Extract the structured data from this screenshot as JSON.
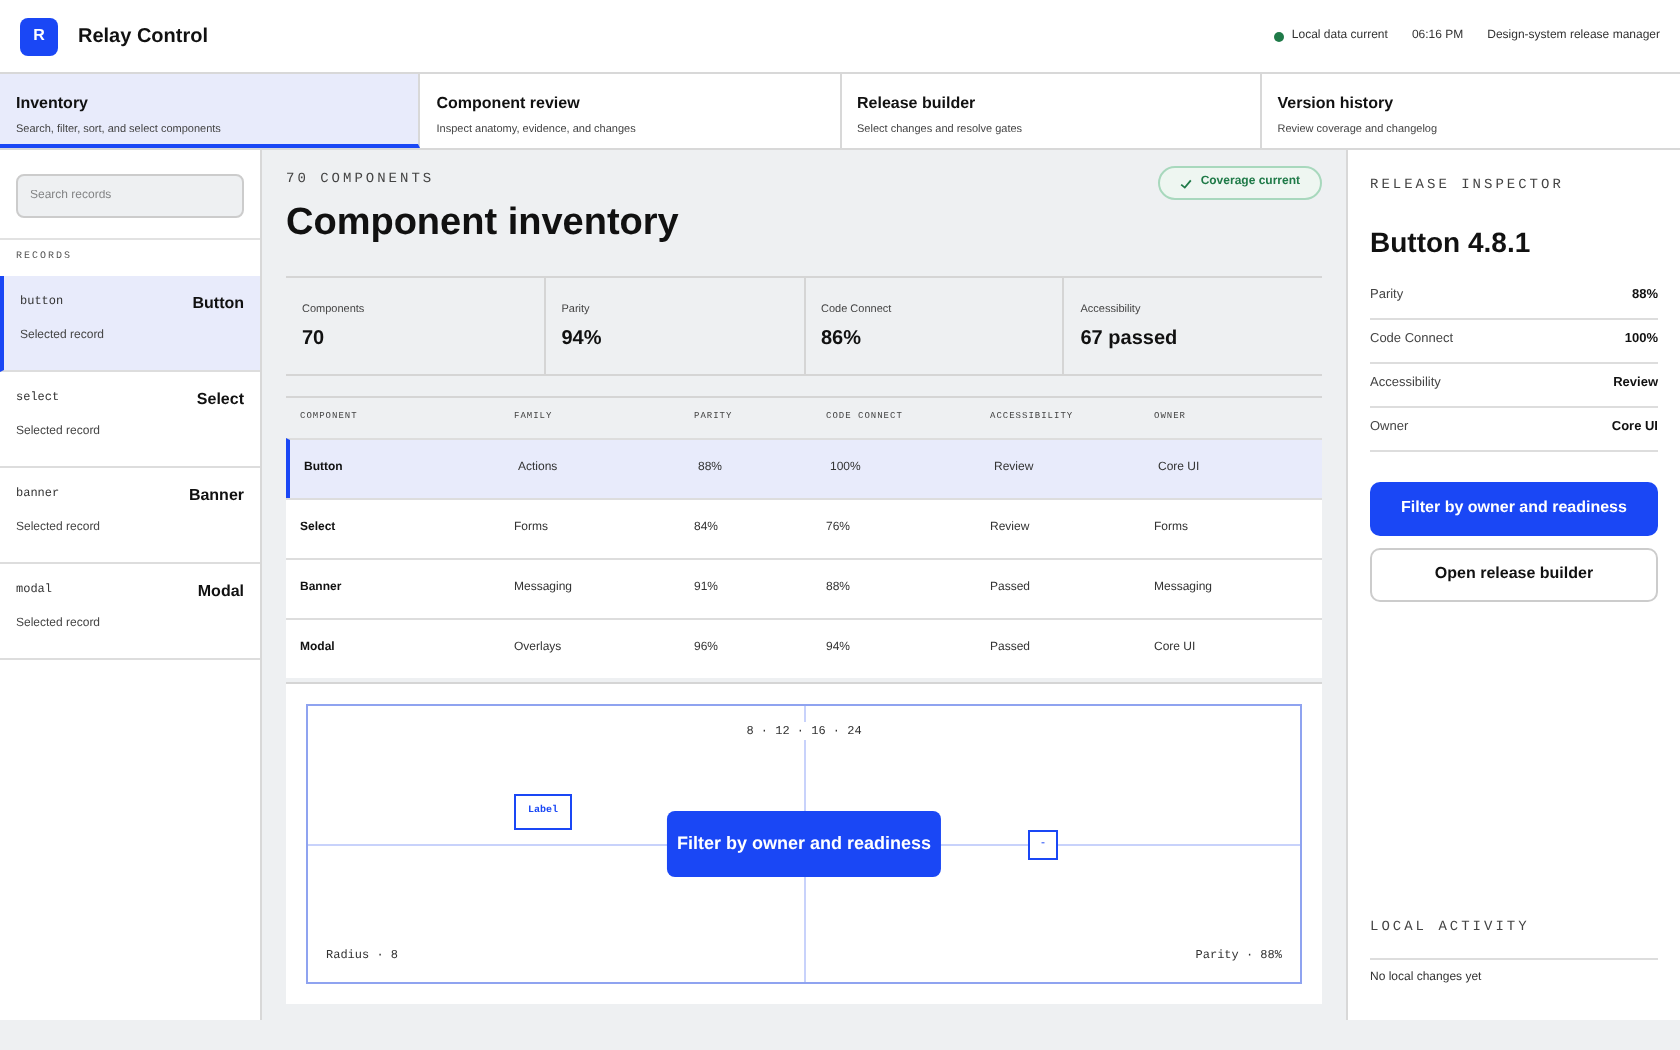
{
  "app": {
    "logo": "R",
    "title": "Relay Control"
  },
  "status": {
    "online": true,
    "label": "Local data current",
    "time": "06:16 PM",
    "role": "Design-system release manager"
  },
  "tabs": [
    {
      "label": "Inventory",
      "description": "Search, filter, sort, and select components",
      "selected": true
    },
    {
      "label": "Component review",
      "description": "Inspect anatomy, evidence, and changes",
      "selected": false
    },
    {
      "label": "Release builder",
      "description": "Select changes and resolve gates",
      "selected": false
    },
    {
      "label": "Version history",
      "description": "Review coverage and changelog",
      "selected": false
    }
  ],
  "sidebar": {
    "search": {
      "placeholder": "Search records"
    },
    "heading": "RECORDS",
    "items": [
      {
        "code": "button",
        "name": "Button",
        "note": "Selected record",
        "selected": true
      },
      {
        "code": "select",
        "name": "Select",
        "note": "Selected record",
        "selected": false
      },
      {
        "code": "banner",
        "name": "Banner",
        "note": "Selected record",
        "selected": false
      },
      {
        "code": "modal",
        "name": "Modal",
        "note": "Selected record",
        "selected": false
      }
    ]
  },
  "main": {
    "eyebrow": "70 COMPONENTS",
    "title": "Component inventory",
    "badge": "Coverage current",
    "stats": [
      {
        "label": "Components",
        "value": "70"
      },
      {
        "label": "Parity",
        "value": "94%"
      },
      {
        "label": "Code Connect",
        "value": "86%"
      },
      {
        "label": "Accessibility",
        "value": "67 passed"
      }
    ],
    "table": {
      "columns": [
        "COMPONENT",
        "FAMILY",
        "PARITY",
        "CODE CONNECT",
        "ACCESSIBILITY",
        "OWNER"
      ],
      "rows": [
        {
          "cells": [
            "Button",
            "Actions",
            "88%",
            "100%",
            "Review",
            "Core UI"
          ],
          "selected": true
        },
        {
          "cells": [
            "Select",
            "Forms",
            "84%",
            "76%",
            "Review",
            "Forms"
          ],
          "selected": false
        },
        {
          "cells": [
            "Banner",
            "Messaging",
            "91%",
            "88%",
            "Passed",
            "Messaging"
          ],
          "selected": false
        },
        {
          "cells": [
            "Modal",
            "Overlays",
            "96%",
            "94%",
            "Passed",
            "Core UI"
          ],
          "selected": false
        }
      ]
    },
    "preview": {
      "spacing": "8 · 12 · 16 · 24",
      "tag": "Label",
      "button": "Filter by owner and readiness",
      "small_box": "-",
      "radius": "Radius · 8",
      "parity": "Parity · 88%"
    }
  },
  "inspector": {
    "heading": "RELEASE INSPECTOR",
    "title": "Button 4.8.1",
    "fields": [
      {
        "label": "Parity",
        "value": "88%"
      },
      {
        "label": "Code Connect",
        "value": "100%"
      },
      {
        "label": "Accessibility",
        "value": "Review"
      },
      {
        "label": "Owner",
        "value": "Core UI"
      }
    ],
    "primary_button": "Filter by owner and readiness",
    "secondary_button": "Open release builder",
    "activity_heading": "LOCAL ACTIVITY",
    "activity_empty": "No local changes yet"
  }
}
